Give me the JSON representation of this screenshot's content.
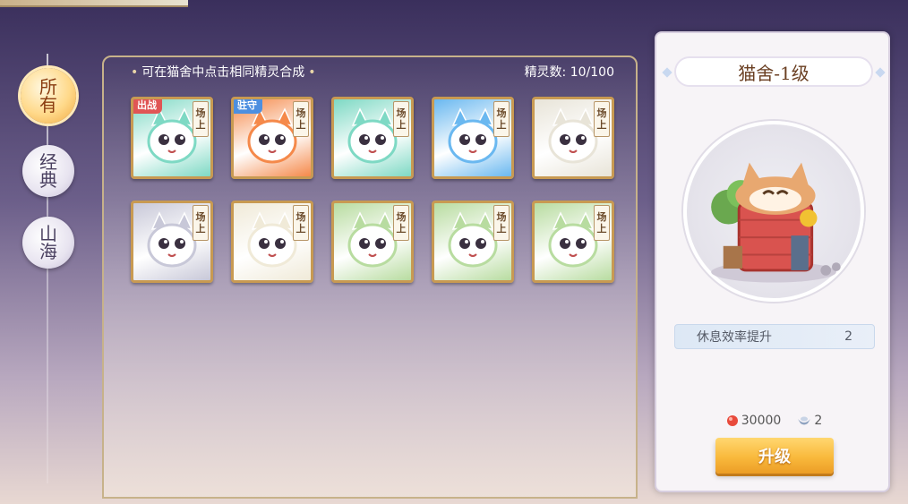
{
  "side_tabs": [
    {
      "label_top": "所",
      "label_bottom": "有",
      "active": true
    },
    {
      "label_top": "经",
      "label_bottom": "典",
      "active": false
    },
    {
      "label_top": "山",
      "label_bottom": "海",
      "active": false
    }
  ],
  "panel": {
    "hint": "可在猫舍中点击相同精灵合成",
    "count_label": "精灵数:",
    "count_value": "10/100"
  },
  "cards": [
    {
      "status": "出战",
      "status_color": "red",
      "onfield_top": "场",
      "onfield_bottom": "上",
      "creature": "teal-dragon-cat",
      "color": "#7ed9c4"
    },
    {
      "status": "驻守",
      "status_color": "blue",
      "onfield_top": "场",
      "onfield_bottom": "上",
      "creature": "fire-fox",
      "color": "#f5894a"
    },
    {
      "status": "",
      "status_color": "",
      "onfield_top": "场",
      "onfield_bottom": "上",
      "creature": "teal-dragon-cat",
      "color": "#7ed9c4"
    },
    {
      "status": "",
      "status_color": "",
      "onfield_top": "场",
      "onfield_bottom": "上",
      "creature": "water-spirit",
      "color": "#6ab8f0"
    },
    {
      "status": "",
      "status_color": "",
      "onfield_top": "场",
      "onfield_bottom": "上",
      "creature": "white-owl-cat",
      "color": "#e8e4d8"
    },
    {
      "status": "",
      "status_color": "",
      "onfield_top": "场",
      "onfield_bottom": "上",
      "creature": "opera-mask-cat",
      "color": "#c8c8d8"
    },
    {
      "status": "",
      "status_color": "",
      "onfield_top": "场",
      "onfield_bottom": "上",
      "creature": "white-lotus-cat",
      "color": "#f0ead8"
    },
    {
      "status": "",
      "status_color": "",
      "onfield_top": "场",
      "onfield_bottom": "上",
      "creature": "leaf-cat",
      "color": "#b8dca0"
    },
    {
      "status": "",
      "status_color": "",
      "onfield_top": "场",
      "onfield_bottom": "上",
      "creature": "leaf-cat",
      "color": "#b8dca0"
    },
    {
      "status": "",
      "status_color": "",
      "onfield_top": "场",
      "onfield_bottom": "上",
      "creature": "leaf-cat",
      "color": "#b8dca0"
    }
  ],
  "building": {
    "title": "猫舍-1级",
    "stat_label": "休息效率提升",
    "stat_value": "2",
    "cost_gold": "30000",
    "cost_silver": "2",
    "upgrade_label": "升级",
    "accent_color": "#f9b93c"
  }
}
